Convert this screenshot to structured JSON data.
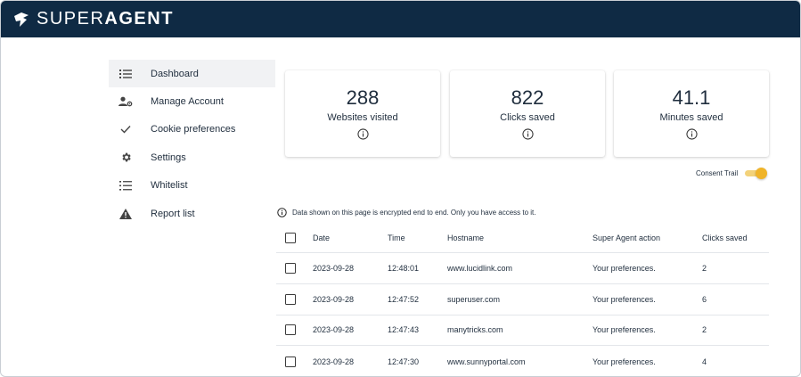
{
  "brand": {
    "part1": "SUPER",
    "part2": "AGENT"
  },
  "sidebar": {
    "items": [
      {
        "label": "Dashboard",
        "icon": "list-icon",
        "active": true
      },
      {
        "label": "Manage Account",
        "icon": "account-gear-icon"
      },
      {
        "label": "Cookie preferences",
        "icon": "check-icon"
      },
      {
        "label": "Settings",
        "icon": "gear-icon"
      },
      {
        "label": "Whitelist",
        "icon": "checklist-icon"
      },
      {
        "label": "Report list",
        "icon": "warning-icon"
      }
    ]
  },
  "stats": [
    {
      "value": "288",
      "label": "Websites visited"
    },
    {
      "value": "822",
      "label": "Clicks saved"
    },
    {
      "value": "41.1",
      "label": "Minutes saved"
    }
  ],
  "consent": {
    "label": "Consent Trail",
    "enabled": true
  },
  "notice": "Data shown on this page is encrypted end to end. Only you have access to it.",
  "table": {
    "headers": {
      "date": "Date",
      "time": "Time",
      "host": "Hostname",
      "action": "Super Agent action",
      "clicks": "Clicks saved"
    },
    "rows": [
      {
        "date": "2023-09-28",
        "time": "12:48:01",
        "host": "www.lucidlink.com",
        "action": "Your preferences.",
        "clicks": "2"
      },
      {
        "date": "2023-09-28",
        "time": "12:47:52",
        "host": "superuser.com",
        "action": "Your preferences.",
        "clicks": "6"
      },
      {
        "date": "2023-09-28",
        "time": "12:47:43",
        "host": "manytricks.com",
        "action": "Your preferences.",
        "clicks": "2"
      },
      {
        "date": "2023-09-28",
        "time": "12:47:30",
        "host": "www.sunnyportal.com",
        "action": "Your preferences.",
        "clicks": "4"
      }
    ]
  },
  "colors": {
    "topbar": "#0f2a44",
    "accent": "#f0b429"
  }
}
